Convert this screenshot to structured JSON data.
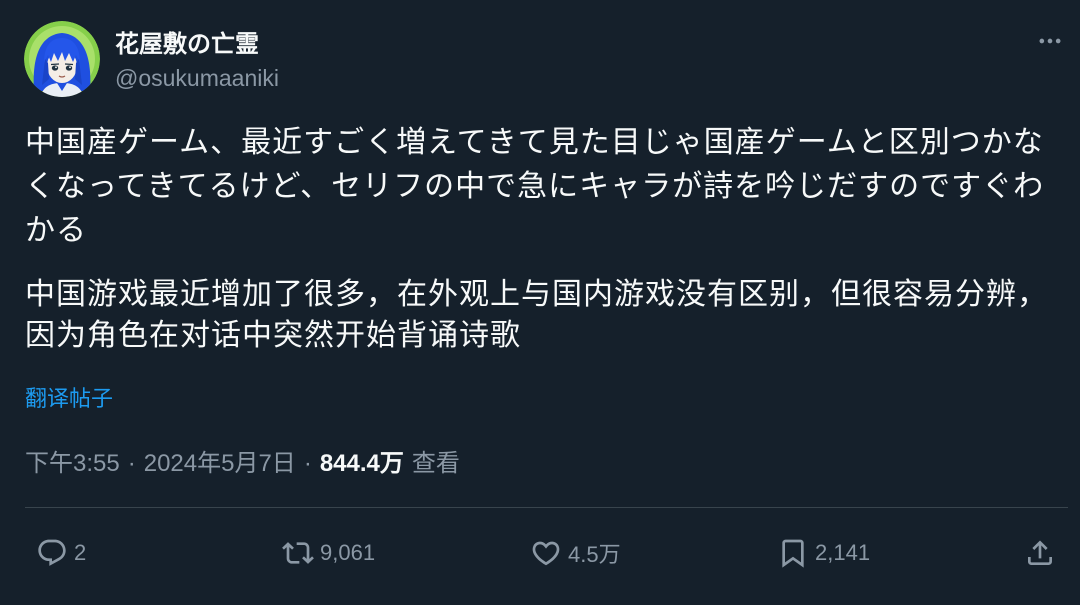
{
  "author": {
    "display_name": "花屋敷の亡霊",
    "handle": "@osukumaaniki"
  },
  "tweet": {
    "text_lines": [
      "中国産ゲーム、最近すごく増えてきて見た目じゃ国産ゲームと区別つかな",
      "くなってきてるけど、セリフの中で急にキャラが詩を吟じだすのですぐわ",
      "かる"
    ],
    "translation_lines": [
      "中国游戏最近增加了很多，在外观上与国内游戏没有区别，但很容易分辨，",
      "因为角色在对话中突然开始背诵诗歌"
    ],
    "translate_link": "翻译帖子"
  },
  "meta": {
    "time": "下午3:55",
    "sep1": "·",
    "date": "2024年5月7日",
    "sep2": "·",
    "views": "844.4万",
    "views_label": "查看"
  },
  "actions": {
    "replies": "2",
    "retweets": "9,061",
    "likes": "4.5万",
    "bookmarks": "2,141"
  },
  "icons": {
    "more": "more-horizontal-icon",
    "reply": "reply-icon",
    "retweet": "retweet-icon",
    "like": "heart-icon",
    "bookmark": "bookmark-icon",
    "share": "share-icon"
  },
  "colors": {
    "background": "#15202b",
    "text_primary": "#f7f9f9",
    "text_secondary": "#8b98a5",
    "accent_link": "#1d9bf0",
    "divider": "#38444d"
  }
}
